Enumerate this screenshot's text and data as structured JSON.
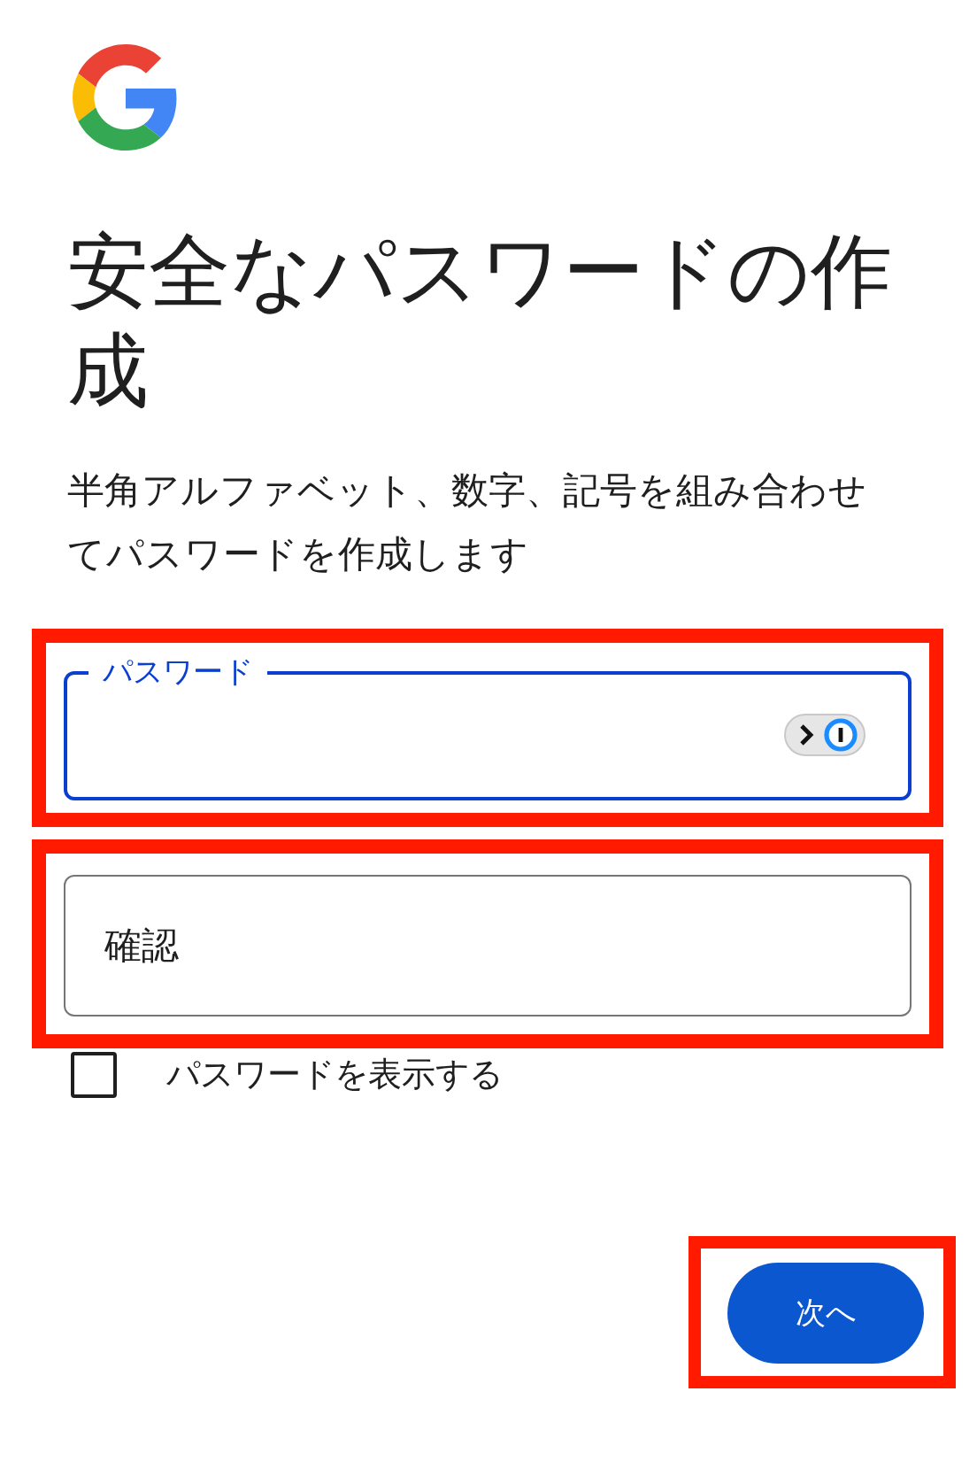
{
  "title": "安全なパスワードの作成",
  "description": "半角アルファベット、数字、記号を組み合わせてパスワードを作成します",
  "fields": [
    {
      "kind": "floating",
      "label": "パスワード",
      "focused": true,
      "highlighted": true
    },
    {
      "kind": "plain",
      "placeholder": "確認",
      "focused": false,
      "highlighted": true
    }
  ],
  "show_password": {
    "label": "パスワードを表示する",
    "checked": false
  },
  "next_button": {
    "label": "次へ",
    "highlighted": true
  }
}
